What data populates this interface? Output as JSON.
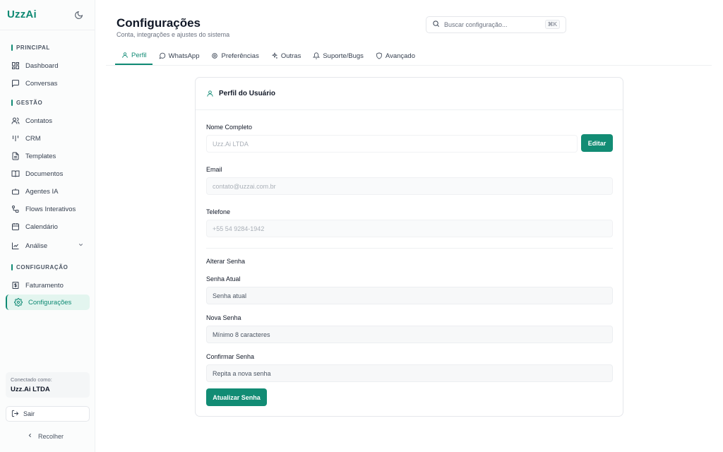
{
  "brand": "UzzAi",
  "colors": {
    "accent": "#0f8a74",
    "button": "#128c74",
    "active_bg": "#e3f5ef"
  },
  "sidebar": {
    "sections": {
      "principal": "PRINCIPAL",
      "gestao": "GESTÃO",
      "configuracao": "CONFIGURAÇÃO"
    },
    "items": [
      {
        "label": "Dashboard",
        "icon": "dashboard-icon"
      },
      {
        "label": "Conversas",
        "icon": "chat-icon"
      },
      {
        "label": "Contatos",
        "icon": "users-icon"
      },
      {
        "label": "CRM",
        "icon": "kanban-icon"
      },
      {
        "label": "Templates",
        "icon": "file-text-icon"
      },
      {
        "label": "Documentos",
        "icon": "book-icon"
      },
      {
        "label": "Agentes IA",
        "icon": "bot-icon"
      },
      {
        "label": "Flows Interativos",
        "icon": "workflow-icon"
      },
      {
        "label": "Calendário",
        "icon": "calendar-icon"
      },
      {
        "label": "Análise",
        "icon": "chart-line-icon"
      },
      {
        "label": "Faturamento",
        "icon": "dollar-icon"
      },
      {
        "label": "Configurações",
        "icon": "gear-icon"
      }
    ],
    "connected_label": "Conectado como:",
    "connected_value": "Uzz.Ai LTDA",
    "logout": "Sair",
    "collapse": "Recolher"
  },
  "header": {
    "title": "Configurações",
    "subtitle": "Conta, integrações e ajustes do sistema",
    "search_placeholder": "Buscar configuração...",
    "search_shortcut": "⌘K"
  },
  "tabs": [
    {
      "label": "Perfil",
      "icon": "user-icon",
      "active": true
    },
    {
      "label": "WhatsApp",
      "icon": "message-circle-icon"
    },
    {
      "label": "Preferências",
      "icon": "gear-icon"
    },
    {
      "label": "Outras",
      "icon": "sparkles-icon"
    },
    {
      "label": "Suporte/Bugs",
      "icon": "bell-icon"
    },
    {
      "label": "Avançado",
      "icon": "shield-icon"
    }
  ],
  "profile": {
    "card_title": "Perfil do Usuário",
    "name_label": "Nome Completo",
    "name_value": "Uzz.Ai LTDA",
    "edit_button": "Editar",
    "email_label": "Email",
    "email_value": "contato@uzzai.com.br",
    "phone_label": "Telefone",
    "phone_value": "+55 54 9284-1942",
    "password_heading": "Alterar Senha",
    "current_label": "Senha Atual",
    "current_placeholder": "Senha atual",
    "new_label": "Nova Senha",
    "new_placeholder": "Mínimo 8 caracteres",
    "confirm_label": "Confirmar Senha",
    "confirm_placeholder": "Repita a nova senha",
    "update_button": "Atualizar Senha"
  }
}
